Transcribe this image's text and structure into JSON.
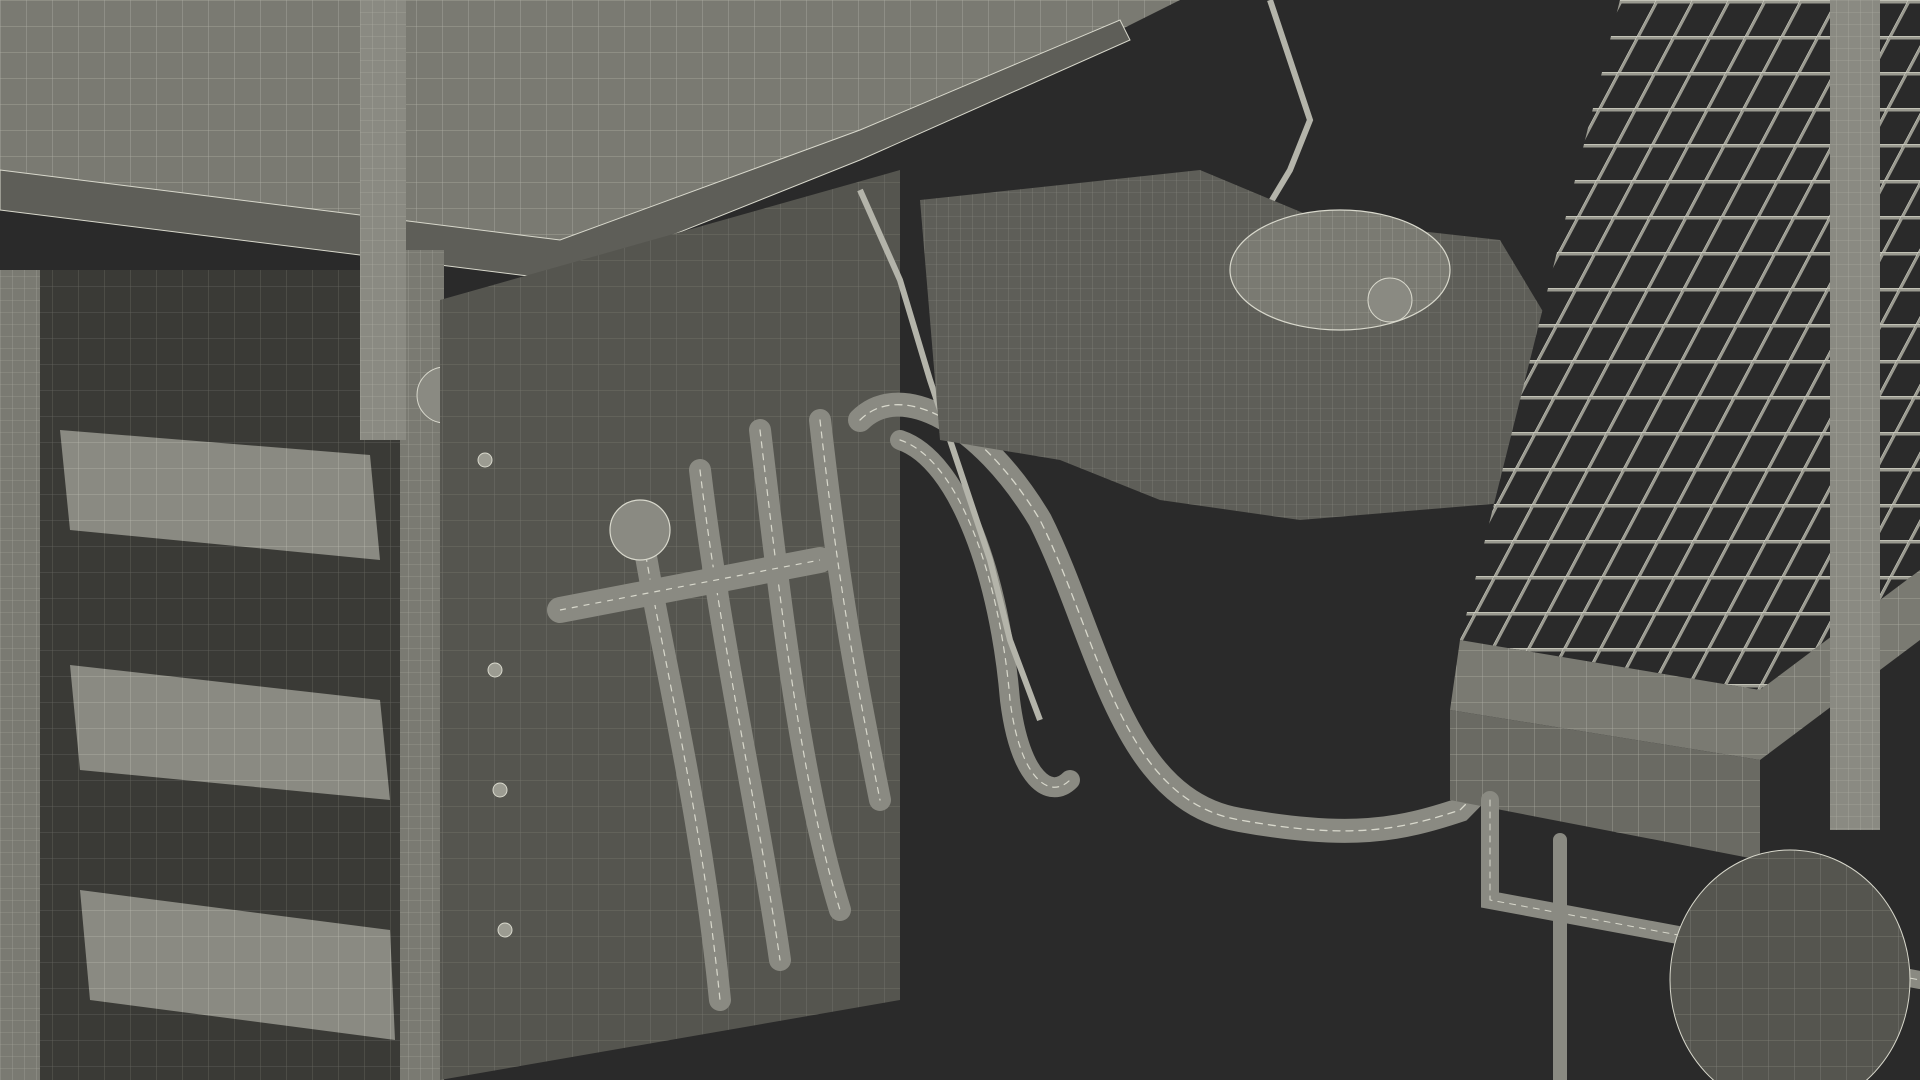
{
  "scene": {
    "background": "#2a2a2a",
    "surface": "#6f6f68",
    "surface_light": "#8a8a82",
    "surface_dark": "#4a4a45",
    "wire": "#d8d8cc",
    "wire_dim": "#9c9c92"
  }
}
